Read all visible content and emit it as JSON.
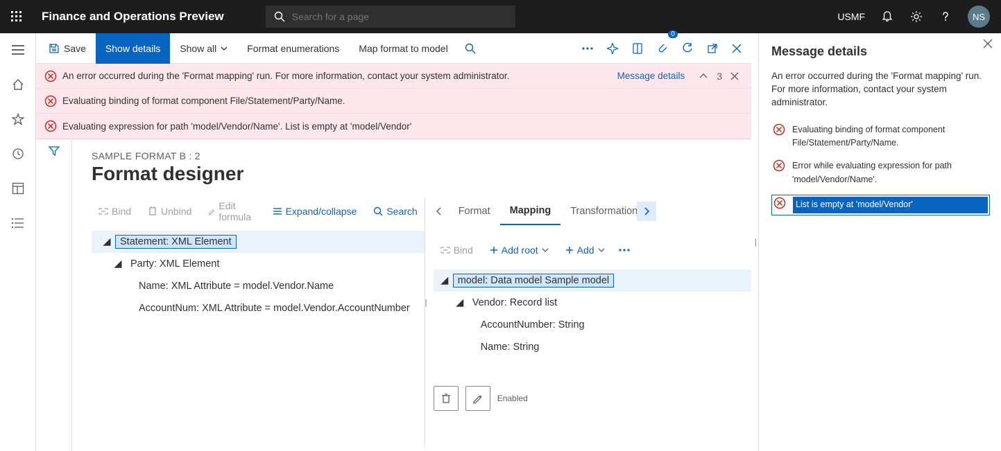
{
  "topbar": {
    "app_title": "Finance and Operations Preview",
    "search_placeholder": "Search for a page",
    "company": "USMF",
    "avatar": "NS"
  },
  "action_pane": {
    "save": "Save",
    "show_details": "Show details",
    "show_all": "Show all",
    "format_enum": "Format enumerations",
    "map_format": "Map format to model",
    "attach_count": "0"
  },
  "messages": {
    "m1": "An error occurred during the 'Format mapping' run. For more information, contact your system administrator.",
    "m2": "Evaluating binding of format component File/Statement/Party/Name.",
    "m3": "Evaluating expression for path 'model/Vendor/Name'.   List is empty at 'model/Vendor'",
    "link": "Message details",
    "count": "3"
  },
  "designer": {
    "breadcrumb": "SAMPLE FORMAT B : 2",
    "title": "Format designer",
    "format_toolbar": {
      "bind": "Bind",
      "unbind": "Unbind",
      "edit_formula": "Edit formula",
      "expand": "Expand/collapse",
      "search": "Search"
    },
    "format_tree": {
      "n1": "Statement: XML Element",
      "n2": "Party: XML Element",
      "n3": "Name: XML Attribute = model.Vendor.Name",
      "n4": "AccountNum: XML Attribute = model.Vendor.AccountNumber"
    },
    "mapping_tabs": {
      "format": "Format",
      "mapping": "Mapping",
      "transform": "Transformations"
    },
    "mapping_toolbar": {
      "bind": "Bind",
      "add_root": "Add root",
      "add": "Add"
    },
    "mapping_tree": {
      "n1": "model: Data model Sample model",
      "n2": "Vendor: Record list",
      "n3": "AccountNumber: String",
      "n4": "Name: String"
    },
    "bottom": {
      "enabled": "Enabled"
    }
  },
  "panel": {
    "title": "Message details",
    "desc": "An error occurred during the 'Format mapping' run. For more information, contact your system administrator.",
    "i1": "Evaluating binding of format component File/Statement/Party/Name.",
    "i2": "Error while evaluating expression for path 'model/Vendor/Name'.",
    "i3": "List is empty at 'model/Vendor'"
  }
}
